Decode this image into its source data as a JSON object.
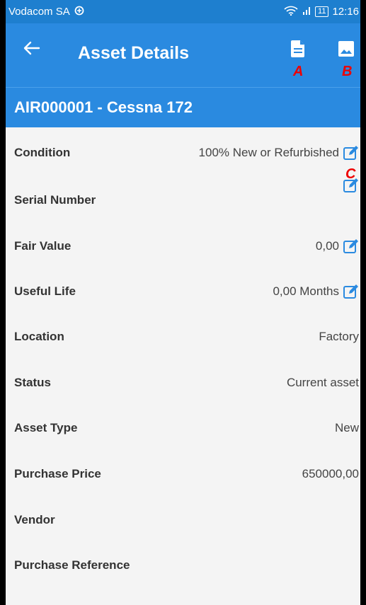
{
  "status_bar": {
    "carrier": "Vodacom SA",
    "battery": "11",
    "time": "12:16"
  },
  "app_bar": {
    "title": "Asset Details",
    "back_icon": "arrow-left-icon",
    "action_a_icon": "document-icon",
    "action_b_icon": "image-icon"
  },
  "annotations": {
    "a": "A",
    "b": "B",
    "c": "C"
  },
  "asset_header": "AIR000001 - Cessna 172",
  "details": [
    {
      "label": "Condition",
      "value": "100% New or Refurbished",
      "editable": true
    },
    {
      "label": "Serial Number",
      "value": "",
      "editable": true
    },
    {
      "label": "Fair Value",
      "value": "0,00",
      "editable": true
    },
    {
      "label": "Useful Life",
      "value": "0,00 Months",
      "editable": true
    },
    {
      "label": "Location",
      "value": "Factory",
      "editable": false
    },
    {
      "label": "Status",
      "value": "Current asset",
      "editable": false
    },
    {
      "label": "Asset Type",
      "value": "New",
      "editable": false
    },
    {
      "label": "Purchase Price",
      "value": "650000,00",
      "editable": false
    },
    {
      "label": "Vendor",
      "value": "",
      "editable": false
    },
    {
      "label": "Purchase Reference",
      "value": "",
      "editable": false
    }
  ],
  "colors": {
    "app_bar": "#2a8ae0",
    "status_bar": "#1e7fcf",
    "edit_icon": "#2a8ae0",
    "annotation": "#e00000"
  }
}
